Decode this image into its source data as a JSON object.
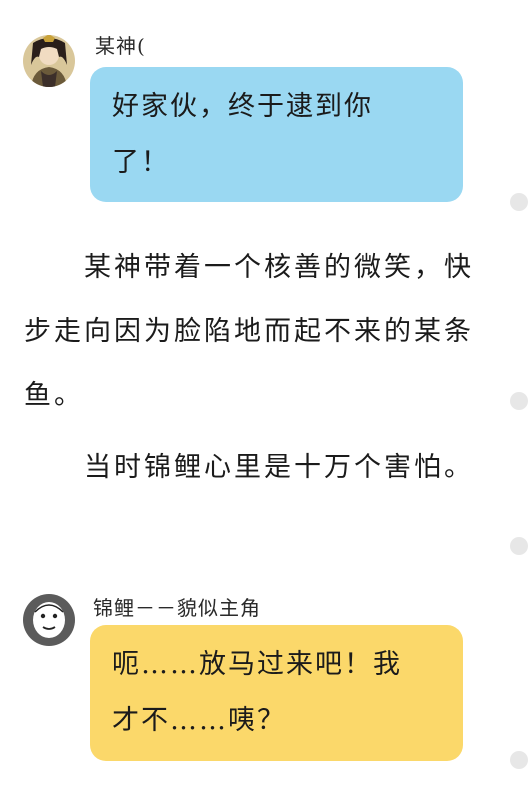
{
  "messages": [
    {
      "speaker": "某神(",
      "text": "好家伙，终于逮到你了！"
    },
    {
      "speaker": "锦鲤－－貌似主角",
      "text": "呃……放马过来吧！我才不……咦？"
    }
  ],
  "narration": [
    "某神带着一个核善的微笑，快步走向因为脸陷地而起不来的某条鱼。",
    "当时锦鲤心里是十万个害怕。"
  ],
  "colors": {
    "bubble_blue": "#9ad8f2",
    "bubble_yellow": "#fbd86a",
    "side_dot": "#e7e7e7"
  }
}
